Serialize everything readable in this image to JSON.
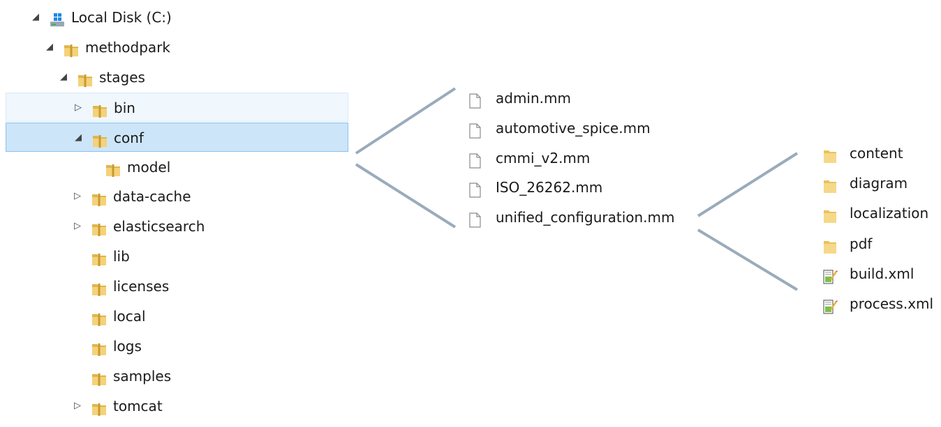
{
  "tree": [
    {
      "label": "Local Disk (C:)",
      "icon": "drive-icon",
      "expander": "expanded",
      "level": 0
    },
    {
      "label": "methodpark",
      "icon": "folder-icon",
      "expander": "expanded",
      "level": 1
    },
    {
      "label": "stages",
      "icon": "folder-icon",
      "expander": "expanded",
      "level": 2
    },
    {
      "label": "bin",
      "icon": "folder-icon",
      "expander": "collapsed",
      "level": 3,
      "state": "hover"
    },
    {
      "label": "conf",
      "icon": "folder-icon",
      "expander": "expanded",
      "level": 3,
      "state": "selected"
    },
    {
      "label": "model",
      "icon": "folder-icon",
      "expander": "none",
      "level": 4
    },
    {
      "label": "data-cache",
      "icon": "folder-icon",
      "expander": "collapsed",
      "level": 3
    },
    {
      "label": "elasticsearch",
      "icon": "folder-icon",
      "expander": "collapsed",
      "level": 3
    },
    {
      "label": "lib",
      "icon": "folder-icon",
      "expander": "none",
      "level": 3
    },
    {
      "label": "licenses",
      "icon": "folder-icon",
      "expander": "none",
      "level": 3
    },
    {
      "label": "local",
      "icon": "folder-icon",
      "expander": "none",
      "level": 3
    },
    {
      "label": "logs",
      "icon": "folder-icon",
      "expander": "none",
      "level": 3
    },
    {
      "label": "samples",
      "icon": "folder-icon",
      "expander": "none",
      "level": 3
    },
    {
      "label": "tomcat",
      "icon": "folder-icon",
      "expander": "collapsed",
      "level": 3
    }
  ],
  "model_files": [
    {
      "label": "admin.mm",
      "icon": "file-icon"
    },
    {
      "label": "automotive_spice.mm",
      "icon": "file-icon"
    },
    {
      "label": "cmmi_v2.mm",
      "icon": "file-icon"
    },
    {
      "label": "ISO_26262.mm",
      "icon": "file-icon"
    },
    {
      "label": "unified_configuration.mm",
      "icon": "file-icon"
    }
  ],
  "config_contents": [
    {
      "label": "content",
      "icon": "folder-plain-icon"
    },
    {
      "label": "diagram",
      "icon": "folder-plain-icon"
    },
    {
      "label": "localization",
      "icon": "folder-plain-icon"
    },
    {
      "label": "pdf",
      "icon": "folder-plain-icon"
    },
    {
      "label": "build.xml",
      "icon": "xml-file-icon"
    },
    {
      "label": "process.xml",
      "icon": "xml-file-icon"
    }
  ],
  "colors": {
    "selected_bg": "#cce5f9",
    "hover_bg": "#f0f7fd",
    "connector": "#9aabbb",
    "folder": "#e8c25a"
  }
}
